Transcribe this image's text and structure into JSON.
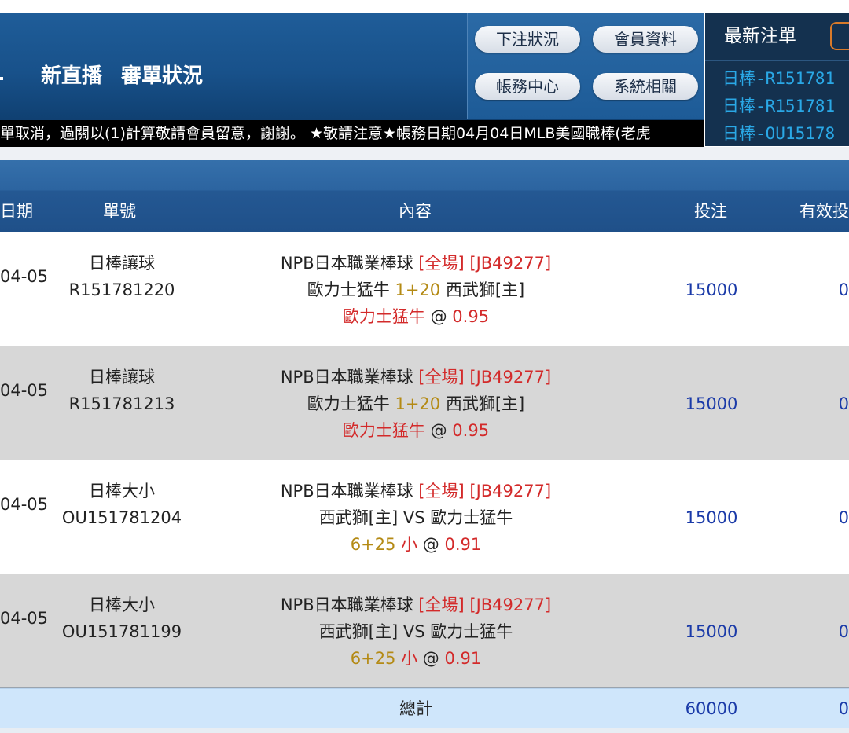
{
  "nav": {
    "items": [
      "新直播",
      "審單狀況"
    ]
  },
  "buttons": {
    "bet_status": "下注狀況",
    "member_info": "會員資料",
    "account_center": "帳務中心",
    "system_related": "系統相關"
  },
  "ticker": {
    "text": "單取消，過關以(1)計算敬請會員留意，謝謝。 ★敬請注意★帳務日期04月04日MLB美國職棒(老虎"
  },
  "latest": {
    "title": "最新注單",
    "items": [
      "日棒-R151781",
      "日棒-R151781",
      "日棒-OU15178"
    ]
  },
  "table": {
    "headers": {
      "date": "日期",
      "ticket": "單號",
      "content": "內容",
      "stake": "投注",
      "valid": "有效投"
    },
    "rows": [
      {
        "date": "04-05",
        "type": "日棒讓球",
        "ticket_no": "R151781220",
        "league": "NPB日本職業棒球",
        "period": "[全場]",
        "code": "[JB49277]",
        "team_a": "歐力士猛牛",
        "line": "1+20",
        "team_b": "西武獅[主]",
        "pick": "歐力士猛牛",
        "at": "@",
        "odds": "0.95",
        "stake": "15000",
        "valid": "0"
      },
      {
        "date": "04-05",
        "type": "日棒讓球",
        "ticket_no": "R151781213",
        "league": "NPB日本職業棒球",
        "period": "[全場]",
        "code": "[JB49277]",
        "team_a": "歐力士猛牛",
        "line": "1+20",
        "team_b": "西武獅[主]",
        "pick": "歐力士猛牛",
        "at": "@",
        "odds": "0.95",
        "stake": "15000",
        "valid": "0"
      },
      {
        "date": "04-05",
        "type": "日棒大小",
        "ticket_no": "OU151781204",
        "league": "NPB日本職業棒球",
        "period": "[全場]",
        "code": "[JB49277]",
        "match": "西武獅[主] VS 歐力士猛牛",
        "ou_line": "6+25",
        "ou_pick": "小",
        "at": "@",
        "odds": "0.91",
        "stake": "15000",
        "valid": "0"
      },
      {
        "date": "04-05",
        "type": "日棒大小",
        "ticket_no": "OU151781199",
        "league": "NPB日本職業棒球",
        "period": "[全場]",
        "code": "[JB49277]",
        "match": "西武獅[主] VS 歐力士猛牛",
        "ou_line": "6+25",
        "ou_pick": "小",
        "at": "@",
        "odds": "0.91",
        "stake": "15000",
        "valid": "0"
      }
    ],
    "total": {
      "label": "總計",
      "stake": "60000",
      "valid": "0"
    }
  },
  "colors": {
    "header_blue": "#1f5d99",
    "accent_red": "#d32a2a",
    "accent_gold": "#b48a14",
    "link_blue": "#2aa8e6",
    "total_bg": "#cfe6fb"
  }
}
